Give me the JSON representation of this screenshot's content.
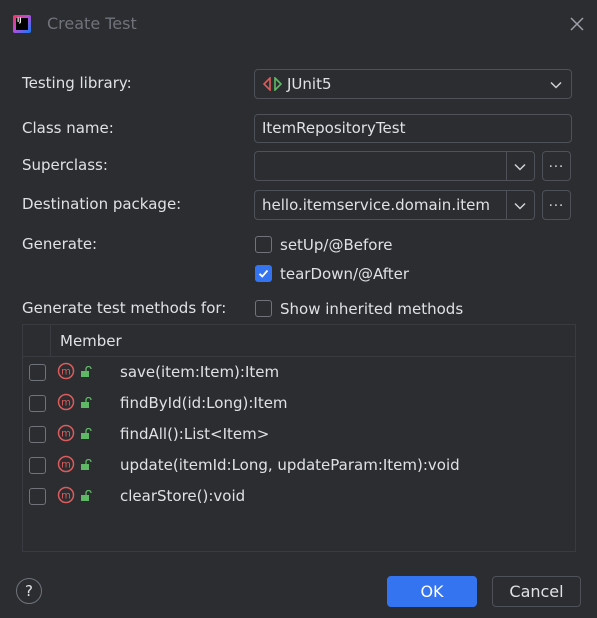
{
  "window": {
    "title": "Create Test"
  },
  "form": {
    "testing_library_label": "Testing library:",
    "testing_library_value": "JUnit5",
    "class_name_label": "Class name:",
    "class_name_value": "ItemRepositoryTest",
    "superclass_label": "Superclass:",
    "superclass_value": "",
    "destination_label": "Destination package:",
    "destination_value": "hello.itemservice.domain.item",
    "browse_label": "...",
    "generate_label": "Generate:",
    "setup_label": "setUp/@Before",
    "setup_checked": false,
    "teardown_label": "tearDown/@After",
    "teardown_checked": true,
    "methods_label": "Generate test methods for:",
    "show_inherited_label": "Show inherited methods",
    "show_inherited_checked": false
  },
  "table": {
    "header": "Member",
    "rows": [
      {
        "label": "save(item:Item):Item",
        "checked": false
      },
      {
        "label": "findById(id:Long):Item",
        "checked": false
      },
      {
        "label": "findAll():List<Item>",
        "checked": false
      },
      {
        "label": "update(itemId:Long, updateParam:Item):void",
        "checked": false
      },
      {
        "label": "clearStore():void",
        "checked": false
      }
    ]
  },
  "footer": {
    "help_label": "?",
    "ok_label": "OK",
    "cancel_label": "Cancel"
  },
  "colors": {
    "accent": "#3574f0",
    "background": "#2b2d30",
    "method_icon": "#db5c5c",
    "lock_icon": "#5fb865"
  },
  "icons": [
    "intellij-app-icon",
    "close-icon",
    "junit-icon",
    "chevron-down-icon",
    "check-icon",
    "method-icon",
    "lock-open-icon",
    "help-icon"
  ]
}
